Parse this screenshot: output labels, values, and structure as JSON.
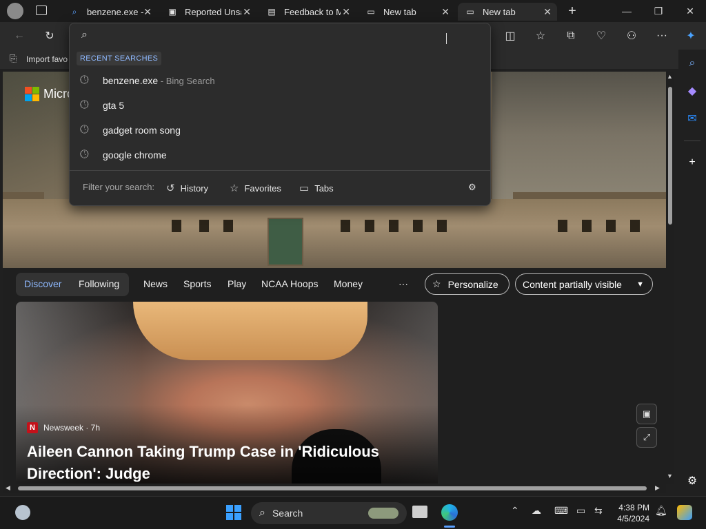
{
  "tabs": [
    {
      "label": "benzene.exe -",
      "icon": "search-icon"
    },
    {
      "label": "Reported Unsa",
      "icon": "report-icon"
    },
    {
      "label": "Feedback to M",
      "icon": "document-icon"
    },
    {
      "label": "New tab",
      "icon": "newtab-icon"
    },
    {
      "label": "New tab",
      "icon": "newtab-icon",
      "active": true
    }
  ],
  "favorites_bar": {
    "import_label": "Import favo"
  },
  "hero": {
    "brand": "Micro"
  },
  "dropdown": {
    "section_label": "RECENT SEARCHES",
    "items": [
      {
        "text": "benzene.exe",
        "sub": " - Bing Search"
      },
      {
        "text": "gta 5",
        "sub": ""
      },
      {
        "text": "gadget room song",
        "sub": ""
      },
      {
        "text": "google chrome",
        "sub": ""
      }
    ],
    "filter_label": "Filter your search:",
    "filters": [
      "History",
      "Favorites",
      "Tabs"
    ]
  },
  "feed_nav": {
    "discover": "Discover",
    "following": "Following",
    "items": [
      "News",
      "Sports",
      "Play",
      "NCAA Hoops",
      "Money"
    ],
    "more": "···",
    "personalize": "Personalize",
    "visibility": "Content partially visible"
  },
  "card": {
    "source": "Newsweek · 7h",
    "headline": "Aileen Cannon Taking Trump Case in 'Ridiculous Direction': Judge"
  },
  "taskbar": {
    "search_label": "Search",
    "time": "4:38 PM",
    "date": "4/5/2024"
  },
  "colors": {
    "accent": "#8fb9ff",
    "ms_red": "#f25022",
    "ms_green": "#7fba00",
    "ms_blue": "#00a4ef",
    "ms_yellow": "#ffb900"
  }
}
